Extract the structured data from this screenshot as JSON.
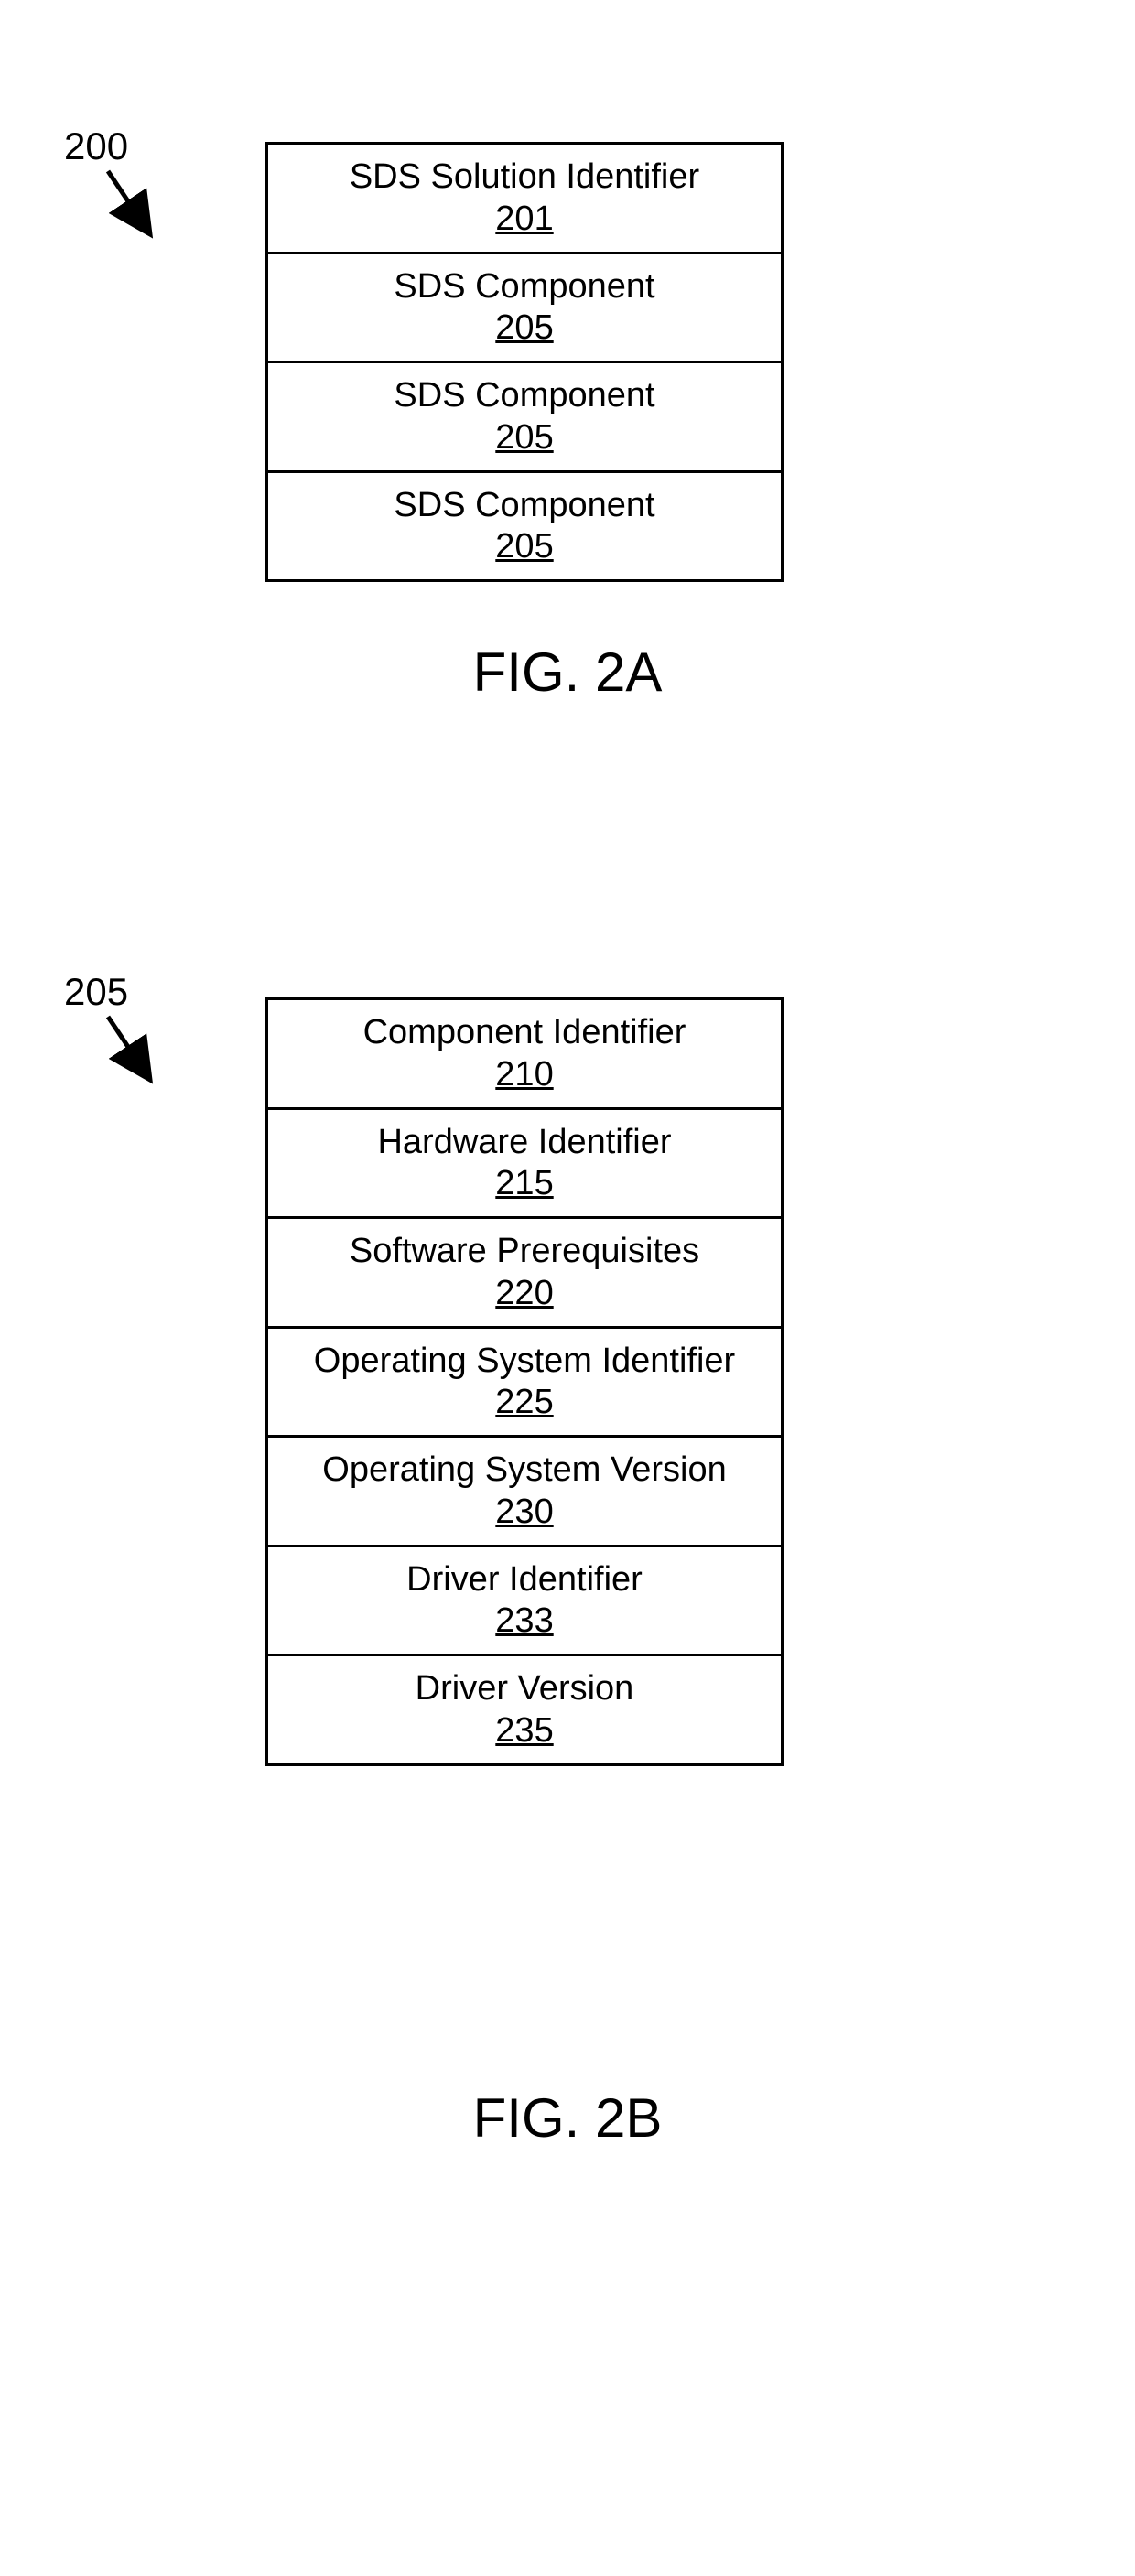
{
  "fig2a": {
    "callout": "200",
    "caption": "FIG. 2A",
    "rows": [
      {
        "label": "SDS Solution Identifier",
        "num": "201"
      },
      {
        "label": "SDS Component",
        "num": "205"
      },
      {
        "label": "SDS Component",
        "num": "205"
      },
      {
        "label": "SDS Component",
        "num": "205"
      }
    ]
  },
  "fig2b": {
    "callout": "205",
    "caption": "FIG. 2B",
    "rows": [
      {
        "label": "Component Identifier",
        "num": "210"
      },
      {
        "label": "Hardware Identifier",
        "num": "215"
      },
      {
        "label": "Software Prerequisites",
        "num": "220"
      },
      {
        "label": "Operating System Identifier",
        "num": "225"
      },
      {
        "label": "Operating System Version",
        "num": "230"
      },
      {
        "label": "Driver Identifier",
        "num": "233"
      },
      {
        "label": "Driver Version",
        "num": "235"
      }
    ]
  }
}
